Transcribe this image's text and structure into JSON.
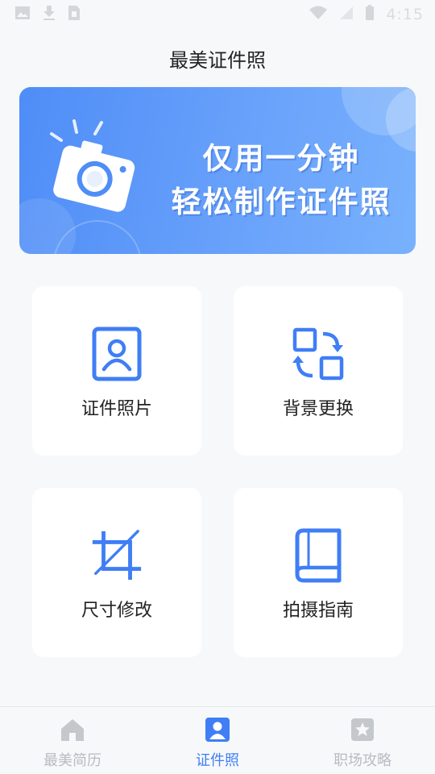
{
  "status_bar": {
    "time": "4:15",
    "icons": [
      "image-icon",
      "download-icon",
      "sim-icon",
      "wifi-icon",
      "signal-icon",
      "battery-icon"
    ]
  },
  "header": {
    "title": "最美证件照"
  },
  "banner": {
    "line1": "仅用一分钟",
    "line2": "轻松制作证件照",
    "icon": "camera-icon"
  },
  "features": [
    {
      "label": "证件照片",
      "icon": "id-photo-icon"
    },
    {
      "label": "背景更换",
      "icon": "swap-background-icon"
    },
    {
      "label": "尺寸修改",
      "icon": "crop-icon"
    },
    {
      "label": "拍摄指南",
      "icon": "book-icon"
    }
  ],
  "bottom_nav": {
    "items": [
      {
        "label": "最美简历",
        "icon": "home-icon",
        "active": false
      },
      {
        "label": "证件照",
        "icon": "portrait-icon",
        "active": true
      },
      {
        "label": "职场攻略",
        "icon": "star-badge-icon",
        "active": false
      }
    ]
  },
  "colors": {
    "accent": "#3f7ef5",
    "inactive": "#b8bcc2",
    "background": "#f7f8fa",
    "banner_start": "#4f8df7",
    "banner_end": "#78b1fc"
  }
}
